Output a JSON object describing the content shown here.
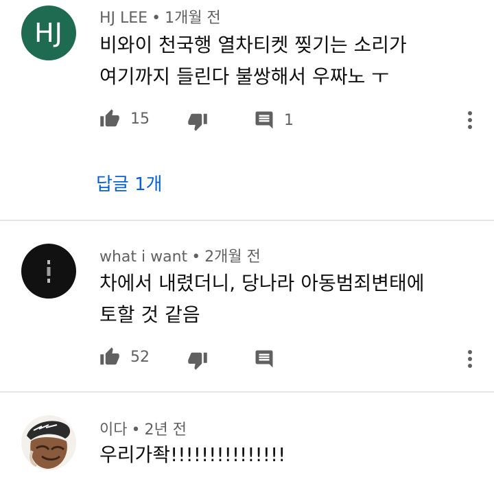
{
  "comments": [
    {
      "author": "HJ LEE",
      "separator": "•",
      "time": "1개월 전",
      "avatar_initials": "HJ",
      "avatar_color": "#1e6b52",
      "text_line1": "비와이 천국행 열차티켓 찢기는 소리가",
      "text_line2": "여기까지 들린다 불쌍해서 우짜노 ㅜ",
      "likes": "15",
      "reply_count": "1",
      "replies_link": "답글 1개"
    },
    {
      "author": "what i want",
      "separator": "•",
      "time": "2개월 전",
      "avatar_color": "#111111",
      "text_line1": "차에서 내렸더니, 당나라 아동범죄변태에",
      "text_line2": "토할 것 같음",
      "likes": "52"
    },
    {
      "author": "이다",
      "separator": "•",
      "time": "2년 전",
      "text_line1": "우리가좍!!!!!!!!!!!!!!!"
    }
  ],
  "icons": {
    "like": "thumb-up-icon",
    "dislike": "thumb-down-icon",
    "reply": "comment-icon",
    "more": "more-vert-icon"
  },
  "colors": {
    "link": "#065fd4",
    "meta": "#606060",
    "icon": "#606060"
  }
}
